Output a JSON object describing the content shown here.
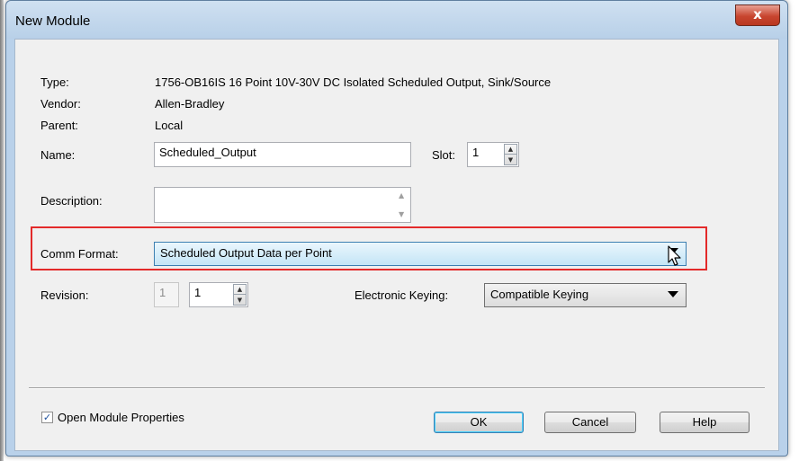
{
  "window": {
    "title": "New Module",
    "close_label": "x"
  },
  "info": {
    "type_label": "Type:",
    "type_value": "1756-OB16IS 16 Point 10V-30V DC Isolated Scheduled Output, Sink/Source",
    "vendor_label": "Vendor:",
    "vendor_value": "Allen-Bradley",
    "parent_label": "Parent:",
    "parent_value": "Local"
  },
  "name": {
    "label": "Name:",
    "value": "Scheduled_Output"
  },
  "slot": {
    "label": "Slot:",
    "value": "1"
  },
  "description": {
    "label": "Description:",
    "value": ""
  },
  "comm_format": {
    "label": "Comm Format:",
    "value": "Scheduled Output Data per Point"
  },
  "revision": {
    "label": "Revision:",
    "major": "1",
    "minor": "1"
  },
  "keying": {
    "label": "Electronic Keying:",
    "value": "Compatible Keying"
  },
  "footer": {
    "open_props_label": "Open Module Properties",
    "open_props_checked": true,
    "ok_label": "OK",
    "cancel_label": "Cancel",
    "help_label": "Help"
  },
  "colors": {
    "highlight": "#e32a2a",
    "selected_combo": "#c4e5f6"
  }
}
